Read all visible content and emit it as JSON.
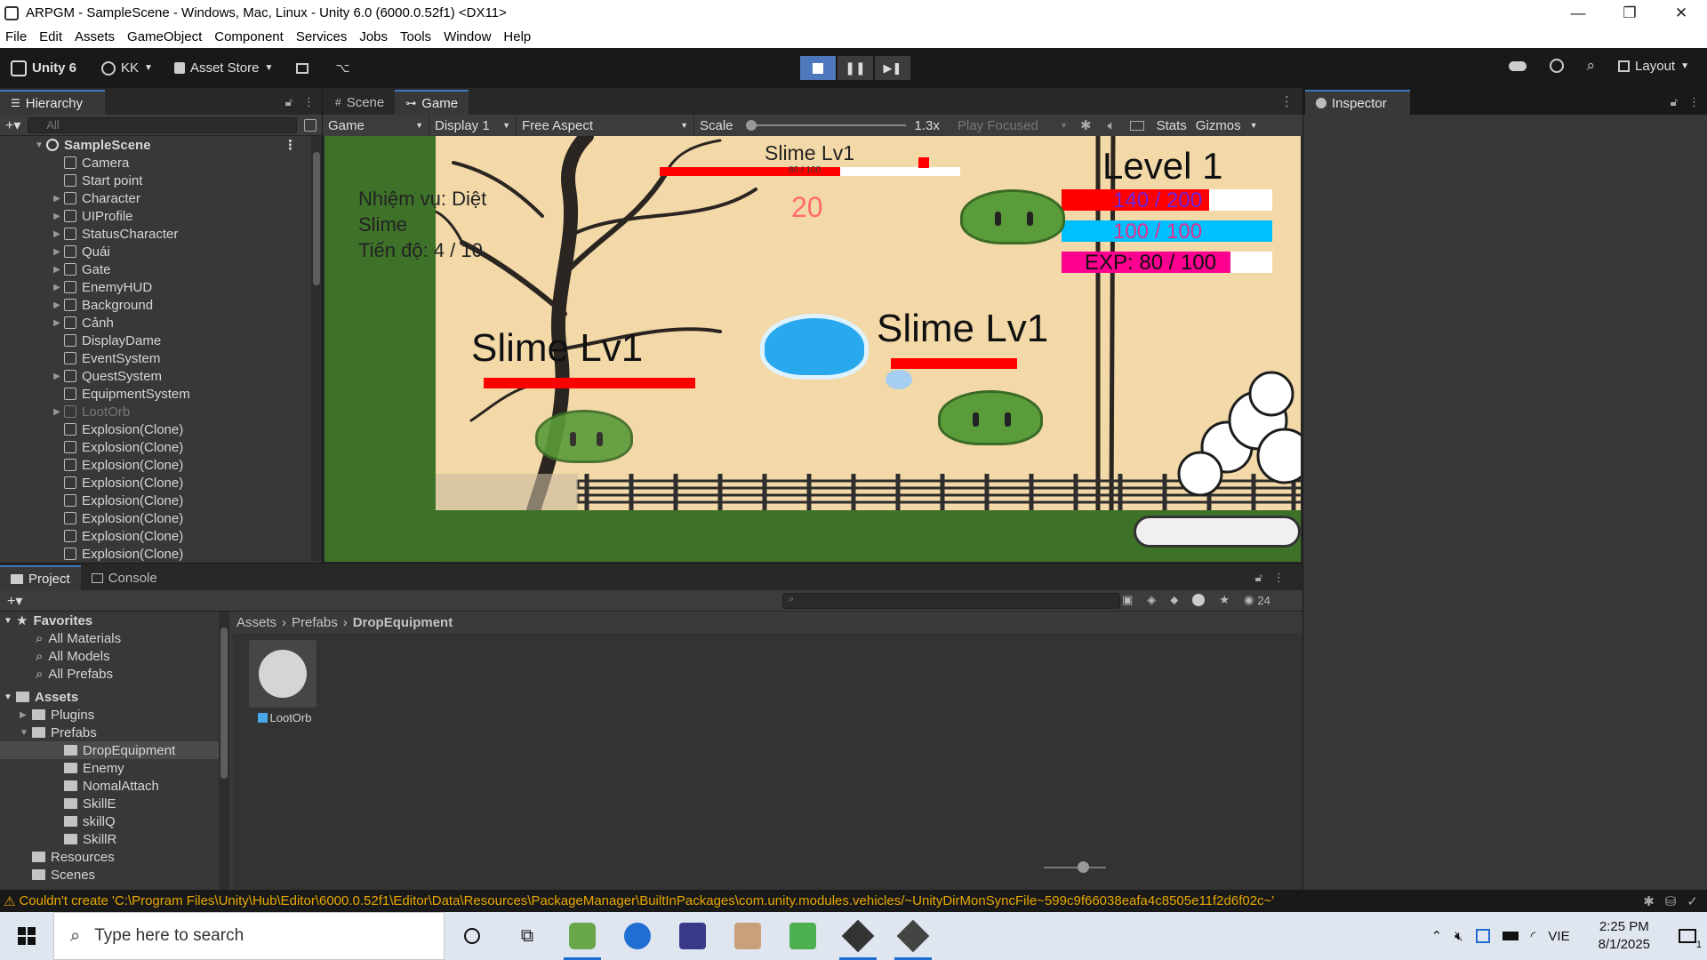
{
  "window": {
    "title": "ARPGM - SampleScene - Windows, Mac, Linux - Unity 6.0 (6000.0.52f1) <DX11>",
    "controls": [
      "—",
      "❐",
      "✕"
    ]
  },
  "menu": [
    "File",
    "Edit",
    "Assets",
    "GameObject",
    "Component",
    "Services",
    "Jobs",
    "Tools",
    "Window",
    "Help"
  ],
  "toolbar": {
    "unity_label": "Unity 6",
    "account_label": "KK",
    "asset_store_label": "Asset Store",
    "layout_label": "Layout"
  },
  "hierarchy": {
    "tab_label": "Hierarchy",
    "search_placeholder": "All",
    "scene_name": "SampleScene",
    "items": [
      {
        "label": "Camera",
        "expandable": false,
        "dim": false
      },
      {
        "label": "Start point",
        "expandable": false,
        "dim": false
      },
      {
        "label": "Character",
        "expandable": true,
        "dim": false
      },
      {
        "label": "UIProfile",
        "expandable": true,
        "dim": false
      },
      {
        "label": "StatusCharacter",
        "expandable": true,
        "dim": false
      },
      {
        "label": "Quái",
        "expandable": true,
        "dim": false
      },
      {
        "label": "Gate",
        "expandable": true,
        "dim": false
      },
      {
        "label": "EnemyHUD",
        "expandable": true,
        "dim": false
      },
      {
        "label": "Background",
        "expandable": true,
        "dim": false
      },
      {
        "label": "Cảnh",
        "expandable": true,
        "dim": false
      },
      {
        "label": "DisplayDame",
        "expandable": false,
        "dim": false
      },
      {
        "label": "EventSystem",
        "expandable": false,
        "dim": false
      },
      {
        "label": "QuestSystem",
        "expandable": true,
        "dim": false
      },
      {
        "label": "EquipmentSystem",
        "expandable": false,
        "dim": false
      },
      {
        "label": "LootOrb",
        "expandable": true,
        "dim": true
      },
      {
        "label": "Explosion(Clone)",
        "expandable": false,
        "dim": false
      },
      {
        "label": "Explosion(Clone)",
        "expandable": false,
        "dim": false
      },
      {
        "label": "Explosion(Clone)",
        "expandable": false,
        "dim": false
      },
      {
        "label": "Explosion(Clone)",
        "expandable": false,
        "dim": false
      },
      {
        "label": "Explosion(Clone)",
        "expandable": false,
        "dim": false
      },
      {
        "label": "Explosion(Clone)",
        "expandable": false,
        "dim": false
      },
      {
        "label": "Explosion(Clone)",
        "expandable": false,
        "dim": false
      },
      {
        "label": "Explosion(Clone)",
        "expandable": false,
        "dim": false
      }
    ]
  },
  "game_panel": {
    "tabs": [
      "Scene",
      "Game"
    ],
    "active_tab": "Game",
    "mode": "Game",
    "display": "Display 1",
    "aspect": "Free Aspect",
    "scale_label": "Scale",
    "scale_value": "1.3x",
    "play_mode": "Play Focused",
    "stats_label": "Stats",
    "gizmos_label": "Gizmos"
  },
  "game": {
    "quest_line1": "Nhiệm vụ: Diệt",
    "quest_line2": "Slime",
    "quest_progress": "Tiến độ: 4 / 10",
    "top_enemy_name": "Slime Lv1",
    "top_enemy_hp_text": "80 / 100",
    "top_enemy_hp_fraction": 0.6,
    "damage_text": "20",
    "level_text": "Level 1",
    "hp_text": "140 / 200",
    "hp_fraction": 0.7,
    "mp_text": "100 / 100",
    "mp_fraction": 1.0,
    "exp_text": "EXP: 80 / 100",
    "exp_fraction": 0.8,
    "slime_left_name": "Slime Lv1",
    "slime_right_name": "Slime Lv1",
    "colors": {
      "hp": "#ff0000",
      "mp": "#00bfff",
      "exp": "#ff0090",
      "sand": "#f3d9a8",
      "grass": "#3d7228",
      "slime": "#5a9c3a"
    }
  },
  "inspector": {
    "tab_label": "Inspector"
  },
  "project": {
    "tabs": [
      "Project",
      "Console"
    ],
    "search_placeholder": "",
    "count": "24",
    "favorites_label": "Favorites",
    "favorites": [
      "All Materials",
      "All Models",
      "All Prefabs"
    ],
    "assets_label": "Assets",
    "tree": [
      {
        "label": "Plugins",
        "indent": 1,
        "selected": false
      },
      {
        "label": "Prefabs",
        "indent": 1,
        "selected": false
      },
      {
        "label": "DropEquipment",
        "indent": 2,
        "selected": true
      },
      {
        "label": "Enemy",
        "indent": 2,
        "selected": false
      },
      {
        "label": "NomalAttach",
        "indent": 2,
        "selected": false
      },
      {
        "label": "SkillE",
        "indent": 2,
        "selected": false
      },
      {
        "label": "skillQ",
        "indent": 2,
        "selected": false
      },
      {
        "label": "SkillR",
        "indent": 2,
        "selected": false
      },
      {
        "label": "Resources",
        "indent": 1,
        "selected": false
      },
      {
        "label": "Scenes",
        "indent": 1,
        "selected": false
      }
    ],
    "breadcrumb": [
      "Assets",
      "Prefabs",
      "DropEquipment"
    ],
    "asset_name": "LootOrb"
  },
  "status": {
    "message": "Couldn't create 'C:\\Program Files\\Unity\\Hub\\Editor\\6000.0.52f1\\Editor\\Data\\Resources\\PackageManager\\BuiltInPackages\\com.unity.modules.vehicles/~UnityDirMonSyncFile~599c9f66038eafa4c8505e11f2d6f02c~'"
  },
  "taskbar": {
    "search_placeholder": "Type here to search",
    "language": "VIE",
    "time": "2:25 PM",
    "date": "8/1/2025",
    "notification_count": "1"
  }
}
